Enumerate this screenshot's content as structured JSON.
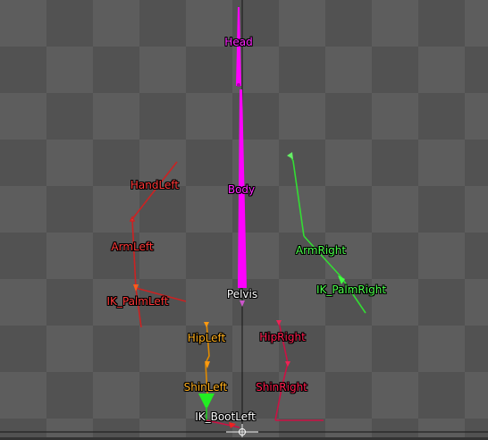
{
  "viewport": {
    "bones": {
      "head": "Head",
      "body": "Body",
      "pelvis": "Pelvis",
      "hand_left": "HandLeft",
      "arm_left": "ArmLeft",
      "ik_palm_left": "IK_PalmLeft",
      "arm_right": "ArmRight",
      "ik_palm_right": "IK_PalmRight",
      "hip_left": "HipLeft",
      "shin_left": "ShinLeft",
      "hip_right": "HipRight",
      "shin_right": "ShinRight",
      "ik_boot_left": "IK_BootLeft"
    },
    "colors": {
      "head_body": "#ff00ff",
      "left_arm": "#cc2222",
      "right_arm": "#33dd33",
      "left_leg": "#ff8c00",
      "right_leg": "#dd1144",
      "ik_boot": "#33ff33",
      "axis": "#1a1a1a"
    },
    "icons": [
      "origin-crosshair-icon"
    ]
  }
}
